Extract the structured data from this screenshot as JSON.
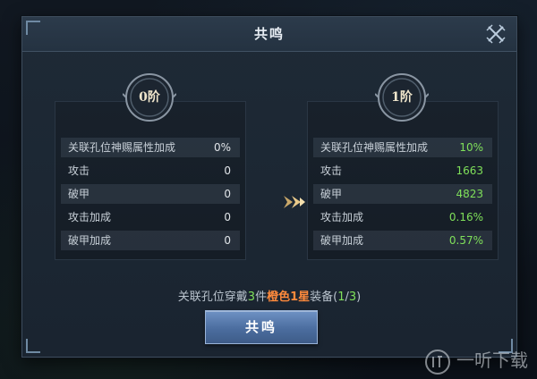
{
  "dialog": {
    "title": "共鸣"
  },
  "left_panel": {
    "tier_label": "0阶",
    "stats": [
      {
        "name": "关联孔位神赐属性加成",
        "value": "0%"
      },
      {
        "name": "攻击",
        "value": "0"
      },
      {
        "name": "破甲",
        "value": "0"
      },
      {
        "name": "攻击加成",
        "value": "0"
      },
      {
        "name": "破甲加成",
        "value": "0"
      }
    ]
  },
  "right_panel": {
    "tier_label": "1阶",
    "stats": [
      {
        "name": "关联孔位神赐属性加成",
        "value": "10%"
      },
      {
        "name": "攻击",
        "value": "1663"
      },
      {
        "name": "破甲",
        "value": "4823"
      },
      {
        "name": "攻击加成",
        "value": "0.16%"
      },
      {
        "name": "破甲加成",
        "value": "0.57%"
      }
    ]
  },
  "requirement": {
    "prefix": "关联孔位穿戴",
    "count": "3",
    "unit": "件",
    "quality": "橙色1星",
    "suffix": "装备(",
    "current": "1",
    "separator": "/",
    "total": "3",
    "close": ")"
  },
  "action": {
    "button_label": "共鸣"
  },
  "watermark": {
    "text": "一听下载"
  },
  "colors": {
    "accent_green": "#7fe05a",
    "accent_orange": "#ff8a3c",
    "button_blue": "#4b6d9f"
  },
  "icons": {
    "close": "close-icon",
    "arrow": "arrow-right-icon",
    "watermark": "watermark-logo-icon"
  }
}
